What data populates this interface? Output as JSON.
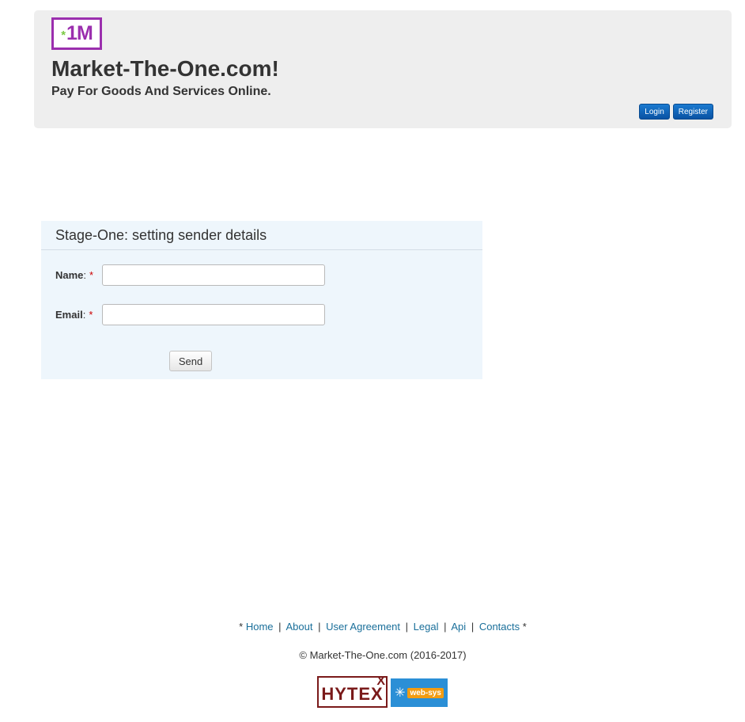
{
  "header": {
    "logo": {
      "star": "*",
      "mark": "1M",
      "colors": {
        "border": "#9b2fae",
        "star": "#7ac943"
      }
    },
    "title": "Market-The-One.com!",
    "tagline": "Pay For Goods And Services Online.",
    "login_label": "Login",
    "register_label": "Register"
  },
  "form": {
    "title": "Stage-One: setting sender details",
    "name_label": "Name",
    "email_label": "Email",
    "colon": ":",
    "required_marker": "*",
    "name_value": "",
    "email_value": "",
    "send_label": "Send"
  },
  "footer": {
    "bullet": "*",
    "links": [
      "Home",
      "About",
      "User Agreement",
      "Legal",
      "Api",
      "Contacts"
    ],
    "separator": "|",
    "copyright": "© Market-The-One.com (2016-2017)",
    "badges": {
      "hytex": {
        "text": "HYTEX",
        "sup": "X"
      },
      "websys": {
        "icon": "snowflake-icon",
        "text": "web-sys"
      }
    }
  },
  "colors": {
    "header_bg": "#eeeeee",
    "form_bg": "#eef6fc",
    "primary_button": "#1a7ad0",
    "link": "#1a6f9a",
    "required": "#cc0000"
  }
}
